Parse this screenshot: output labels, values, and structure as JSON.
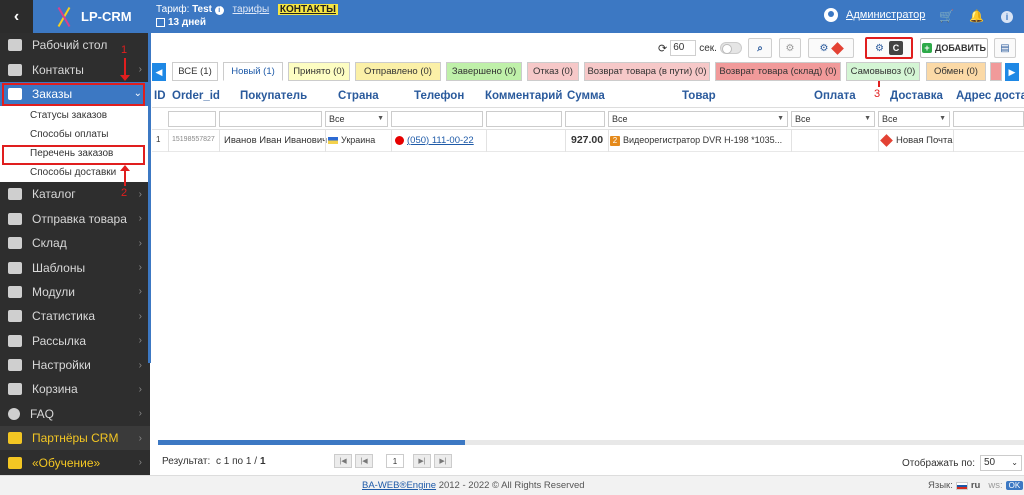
{
  "app": {
    "logo": "LP-CRM"
  },
  "header": {
    "tariff_label": "Тариф:",
    "tariff_name": "Test",
    "tariffs_link": "тарифы",
    "contacts_link": "КОНТАКТЫ",
    "days_left": "13 дней",
    "admin": "Администратор"
  },
  "sidebar": {
    "items": [
      {
        "label": "Рабочий стол"
      },
      {
        "label": "Контакты"
      },
      {
        "label": "Заказы"
      },
      {
        "label": "Каталог"
      },
      {
        "label": "Отправка товара"
      },
      {
        "label": "Склад"
      },
      {
        "label": "Шаблоны"
      },
      {
        "label": "Модули"
      },
      {
        "label": "Статистика"
      },
      {
        "label": "Рассылка"
      },
      {
        "label": "Настройки"
      },
      {
        "label": "Корзина"
      },
      {
        "label": "FAQ"
      },
      {
        "label": "Партнёры CRM"
      },
      {
        "label": "«Обучение»"
      }
    ],
    "sub_items": [
      {
        "label": "Статусы заказов"
      },
      {
        "label": "Способы оплаты"
      },
      {
        "label": "Перечень заказов"
      },
      {
        "label": "Способы доставки"
      }
    ]
  },
  "annotations": {
    "n1": "1",
    "n2": "2",
    "n3": "3"
  },
  "toolbar": {
    "refresh_value": "60",
    "refresh_unit": "сек.",
    "c_button": "C",
    "add_label": "ДОБАВИТЬ"
  },
  "tabs": [
    {
      "label": "ВСЕ (1)"
    },
    {
      "label": "Новый (1)"
    },
    {
      "label": "Принято (0)"
    },
    {
      "label": "Отправлено (0)"
    },
    {
      "label": "Завершено (0)"
    },
    {
      "label": "Отказ (0)"
    },
    {
      "label": "Возврат товара (в пути) (0)"
    },
    {
      "label": "Возврат товара (склад) (0)"
    },
    {
      "label": "Самовывоз (0)"
    },
    {
      "label": "Обмен (0)"
    }
  ],
  "table": {
    "headers": [
      "ID",
      "Order_id",
      "Покупатель",
      "Страна",
      "Телефон",
      "Комментарий",
      "Сумма",
      "Товар",
      "Оплата",
      "Доставка",
      "Адрес доставки"
    ],
    "filter_all": "Все",
    "rows": [
      {
        "id": "1",
        "order_id": "15198557827",
        "customer": "Иванов Иван Иванович",
        "country": "Украина",
        "phone": "(050) 111-00-22",
        "comment": "",
        "sum": "927.00",
        "product_qty": "2",
        "product": "Видеорегистратор DVR H-198 *1035...",
        "payment": "",
        "delivery": "Новая Почта",
        "address": ""
      }
    ]
  },
  "footer": {
    "result_label": "Результат:",
    "result_value": "с 1 по 1 /",
    "result_total": "1",
    "page": "1",
    "per_page_label": "Отображать по:",
    "per_page": "50",
    "copyright_link": "BA-WEB®Engine",
    "copyright_text": "2012 - 2022 © All Rights Reserved",
    "lang_label": "Язык:",
    "lang": "ru",
    "ws_label": "ws:",
    "ws_value": "OK"
  },
  "colors": {
    "brand": "#3c78c3",
    "sidebar": "#2e2e2e",
    "highlight": "#e01e1e",
    "partner": "#f3c623"
  }
}
